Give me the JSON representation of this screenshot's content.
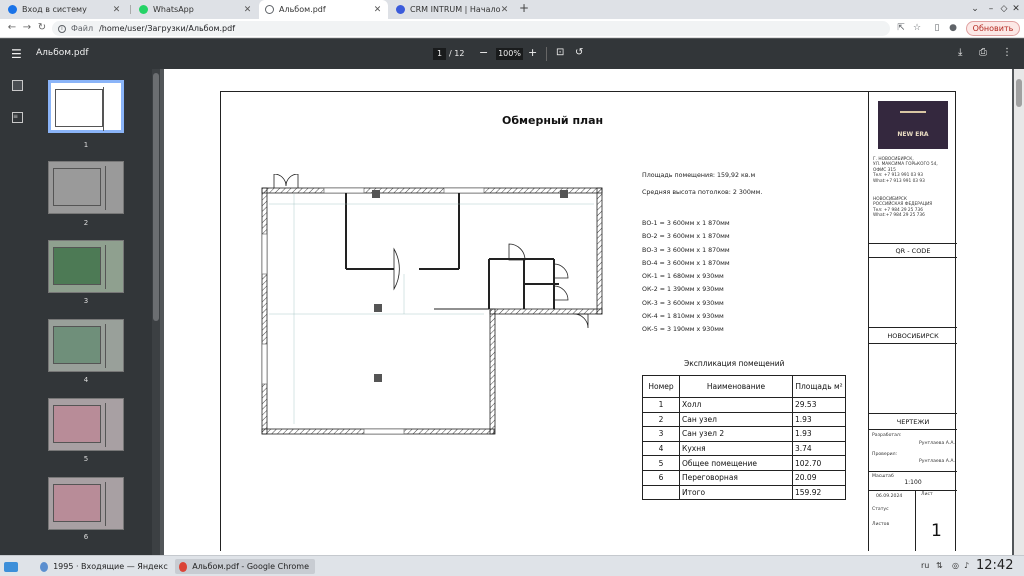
{
  "browser": {
    "tabs": [
      {
        "title": "Вход в систему",
        "color": "#1a73e8"
      },
      {
        "title": "WhatsApp",
        "color": "#25d366"
      },
      {
        "title": "Альбом.pdf",
        "color": "#5f6368"
      },
      {
        "title": "CRM INTRUM | Начало пер",
        "color": "#3b5bdb"
      }
    ],
    "address_scheme": "Файл",
    "address_url": "/home/user/Загрузки/Альбом.pdf",
    "update_label": "Обновить"
  },
  "pdf": {
    "filename": "Альбом.pdf",
    "current_page": "1",
    "total_pages": "/ 12",
    "zoom": "100%",
    "thumbnails": [
      "1",
      "2",
      "3",
      "4",
      "5",
      "6"
    ]
  },
  "document": {
    "title": "Обмерный план",
    "area": "Площадь помещения: 159,92 кв.м",
    "ceiling": "Средняя высота потолков: 2 300мм.",
    "openings": [
      "ВО-1 = 3 600мм х 1 870мм",
      "ВО-2 = 3 600мм х 1 870мм",
      "ВО-3 = 3 600мм х 1 870мм",
      "ВО-4 = 3 600мм х 1 870мм",
      "ОК-1 = 1 680мм х 930мм",
      "ОК-2 = 1 390мм х 930мм",
      "ОК-3 = 3 600мм х 930мм",
      "ОК-4 = 1 810мм х 930мм",
      "ОК-5 = 3 190мм х 930мм"
    ],
    "explication_title": "Экспликация помещений",
    "table_headers": [
      "Номер",
      "Наименование",
      "Площадь м²"
    ],
    "rows": [
      {
        "num": "1",
        "name": "Холл",
        "area": "29.53"
      },
      {
        "num": "2",
        "name": "Сан узел",
        "area": "1.93"
      },
      {
        "num": "3",
        "name": "Сан узел 2",
        "area": "1.93"
      },
      {
        "num": "4",
        "name": "Кухня",
        "area": "3.74"
      },
      {
        "num": "5",
        "name": "Общее помещение",
        "area": "102.70"
      },
      {
        "num": "6",
        "name": "Переговорная",
        "area": "20.09"
      }
    ],
    "total_label": "Итого",
    "total_value": "159.92",
    "stamp": {
      "brand": "NEW ERA",
      "addr1": [
        "Г. НОВОСИБИРСК,",
        "УЛ. МАКСИМА ГОРЬКОГО 54,",
        "ОФИС 315",
        "Тел: +7 913 991 03 93",
        "What:+7 913 991 03 93"
      ],
      "addr2": [
        "НОВОСИБИРСК",
        "РОССИЙСКАЯ ФЕДЕРАЦИЯ",
        "Тел: +7 984 29 25 736",
        "What:+7 984 29 25 736"
      ],
      "qr": "QR - CODE",
      "city": "НОВОСИБИРСК",
      "section": "ЧЕРТЕЖИ",
      "developed_label": "Разработал:",
      "developed_name": "Рунтлаева А.А.",
      "checked_label": "Проверил:",
      "checked_name": "Рунтлаева А.А.",
      "scale_label": "Масштаб",
      "scale": "1:100",
      "date": "06.09.2024",
      "sheet_label": "Лист",
      "status_label": "Статус",
      "sheets_label": "Листов",
      "sheet_number": "1"
    }
  },
  "taskbar": {
    "items": [
      {
        "title": "1995 · Входящие — Яндекс Почт..."
      },
      {
        "title": "Альбом.pdf - Google Chrome"
      }
    ],
    "lang": "ru",
    "time": "12:42"
  }
}
